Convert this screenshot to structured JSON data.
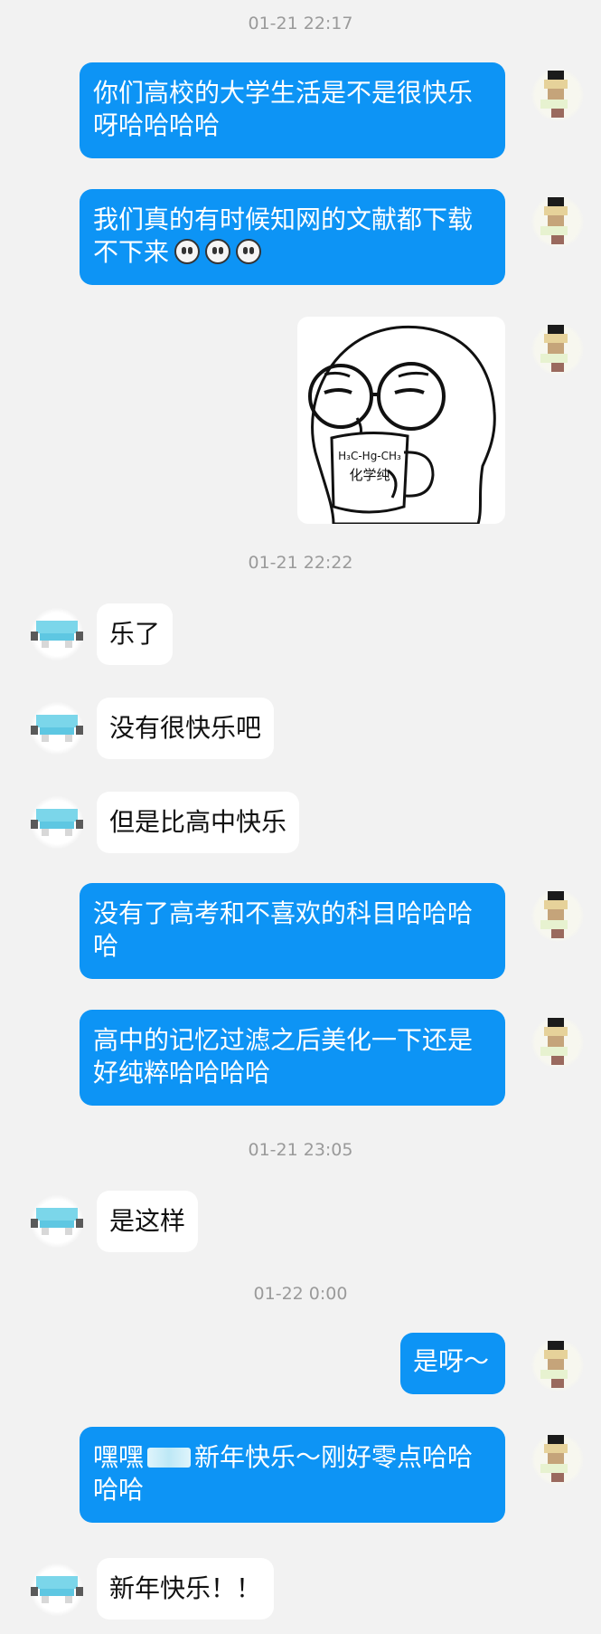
{
  "timestamps": [
    "01-21 22:17",
    "01-21 22:22",
    "01-21 23:05",
    "01-22 0:00"
  ],
  "messages": {
    "m1": "你们高校的大学生活是不是很快乐呀哈哈哈哈",
    "m2": "我们真的有时候知网的文献都下载不下来",
    "m3": "乐了",
    "m4": "没有很快乐吧",
    "m5": "但是比高中快乐",
    "m6": "没有了高考和不喜欢的科目哈哈哈哈",
    "m7": "高中的记忆过滤之后美化一下还是好纯粹哈哈哈哈",
    "m8": "是这样",
    "m9": "是呀～",
    "m10_prefix": "嘿嘿",
    "m10_suffix": "新年快乐～刚好零点哈哈哈哈",
    "m11": "新年快乐！！"
  },
  "sticker": {
    "mug_formula": "H₃C-Hg-CH₃",
    "mug_text": "化学纯"
  },
  "colors": {
    "background": "#f2f2f2",
    "outgoing_bubble": "#0d94f5",
    "incoming_bubble": "#ffffff",
    "timestamp": "#9a9a9a"
  },
  "icons": {
    "emoji": "scared-face-icon"
  }
}
